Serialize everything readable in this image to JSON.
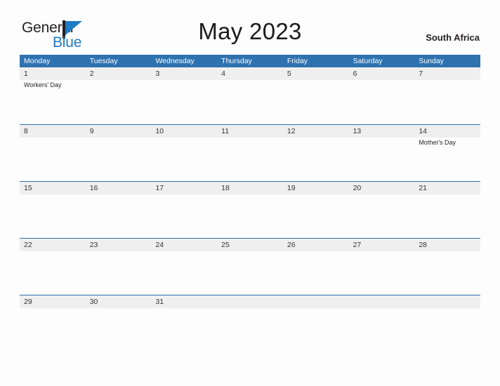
{
  "logo": {
    "text_primary": "General",
    "text_secondary": "Blue",
    "flag_icon": "flag-triangle-icon",
    "accent_color": "#1f7bc4"
  },
  "header": {
    "title": "May 2023",
    "country": "South Africa"
  },
  "colors": {
    "header_blue": "#2e72b0",
    "band_gray": "#efefef",
    "logo_blue": "#1f7bc4",
    "text_dark": "#231f20",
    "page_background": "#fdfdfd"
  },
  "calendar": {
    "month": "May",
    "year": "2023",
    "weekday_headers": [
      "Monday",
      "Tuesday",
      "Wednesday",
      "Thursday",
      "Friday",
      "Saturday",
      "Sunday"
    ],
    "weeks": [
      {
        "days": [
          {
            "number": "1",
            "events": [
              "Workers' Day"
            ]
          },
          {
            "number": "2",
            "events": []
          },
          {
            "number": "3",
            "events": []
          },
          {
            "number": "4",
            "events": []
          },
          {
            "number": "5",
            "events": []
          },
          {
            "number": "6",
            "events": []
          },
          {
            "number": "7",
            "events": []
          }
        ]
      },
      {
        "days": [
          {
            "number": "8",
            "events": []
          },
          {
            "number": "9",
            "events": []
          },
          {
            "number": "10",
            "events": []
          },
          {
            "number": "11",
            "events": []
          },
          {
            "number": "12",
            "events": []
          },
          {
            "number": "13",
            "events": []
          },
          {
            "number": "14",
            "events": [
              "Mother's Day"
            ]
          }
        ]
      },
      {
        "days": [
          {
            "number": "15",
            "events": []
          },
          {
            "number": "16",
            "events": []
          },
          {
            "number": "17",
            "events": []
          },
          {
            "number": "18",
            "events": []
          },
          {
            "number": "19",
            "events": []
          },
          {
            "number": "20",
            "events": []
          },
          {
            "number": "21",
            "events": []
          }
        ]
      },
      {
        "days": [
          {
            "number": "22",
            "events": []
          },
          {
            "number": "23",
            "events": []
          },
          {
            "number": "24",
            "events": []
          },
          {
            "number": "25",
            "events": []
          },
          {
            "number": "26",
            "events": []
          },
          {
            "number": "27",
            "events": []
          },
          {
            "number": "28",
            "events": []
          }
        ]
      },
      {
        "days": [
          {
            "number": "29",
            "events": []
          },
          {
            "number": "30",
            "events": []
          },
          {
            "number": "31",
            "events": []
          },
          {
            "number": "",
            "events": []
          },
          {
            "number": "",
            "events": []
          },
          {
            "number": "",
            "events": []
          },
          {
            "number": "",
            "events": []
          }
        ]
      }
    ]
  }
}
